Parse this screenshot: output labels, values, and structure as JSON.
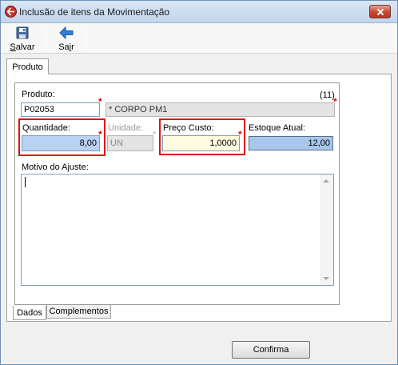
{
  "window": {
    "title": "Inclusão de itens da Movimentação"
  },
  "toolbar": {
    "save_label_underlined": "S",
    "save_label_rest": "alvar",
    "exit_label_prefix": "Sa",
    "exit_label_underlined": "i",
    "exit_label_rest": "r"
  },
  "tabs": {
    "top": "Produto",
    "bottom": [
      "Dados",
      "Complementos"
    ]
  },
  "form": {
    "produto_label": "Produto:",
    "produto_code": "P02053",
    "produto_desc": "* CORPO PM1",
    "count": "(11)",
    "quantidade_label": "Quantidade:",
    "quantidade_value": "8,00",
    "unidade_label": "Unidade:",
    "unidade_value": "UN",
    "preco_label": "Preço Custo:",
    "preco_value": "1,0000",
    "estoque_label": "Estoque Atual:",
    "estoque_value": "12,00",
    "motivo_label": "Motivo do Ajuste:",
    "motivo_value": ""
  },
  "footer": {
    "confirm_label": "Confirma"
  },
  "colors": {
    "highlight_border": "#e01010",
    "required_mark": "#e00000",
    "quantidade_bg": "#b9d1f2",
    "preco_bg": "#fffbe1",
    "estoque_bg": "#a9c6ec"
  },
  "icons": [
    "app-icon",
    "close-icon",
    "floppy-disk-icon",
    "back-arrow-icon",
    "scroll-up-icon",
    "scroll-down-icon"
  ]
}
